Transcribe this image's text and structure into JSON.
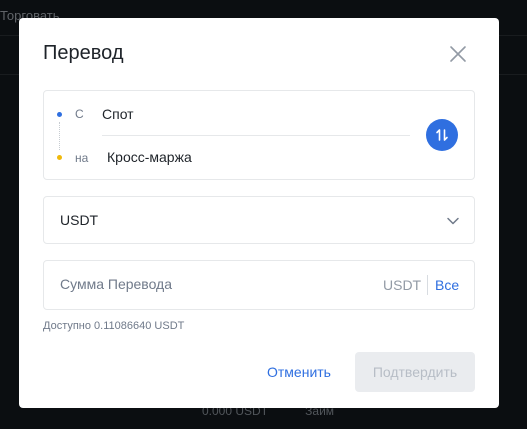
{
  "background": {
    "top_text": "Торговать",
    "bottom_amount": "0.000 USDT",
    "bottom_action": "Займ"
  },
  "modal": {
    "title": "Перевод",
    "from_label": "С",
    "from_wallet": "Спот",
    "to_label": "на",
    "to_wallet": "Кросс-маржа",
    "coin": "USDT",
    "amount_placeholder": "Сумма Перевода",
    "amount_value": "",
    "amount_unit": "USDT",
    "max_label": "Все",
    "available": "Доступно 0.11086640 USDT",
    "cancel_label": "Отменить",
    "confirm_label": "Подтвердить"
  },
  "icons": {
    "close": "close-icon",
    "swap": "swap-arrows-icon",
    "chevron": "chevron-down-icon"
  },
  "colors": {
    "accent": "#2f6fe0",
    "from_dot": "#2f6fe0",
    "to_dot": "#f0b90b",
    "confirm_disabled_bg": "#eaecef",
    "confirm_disabled_text": "#b7bdc6"
  }
}
